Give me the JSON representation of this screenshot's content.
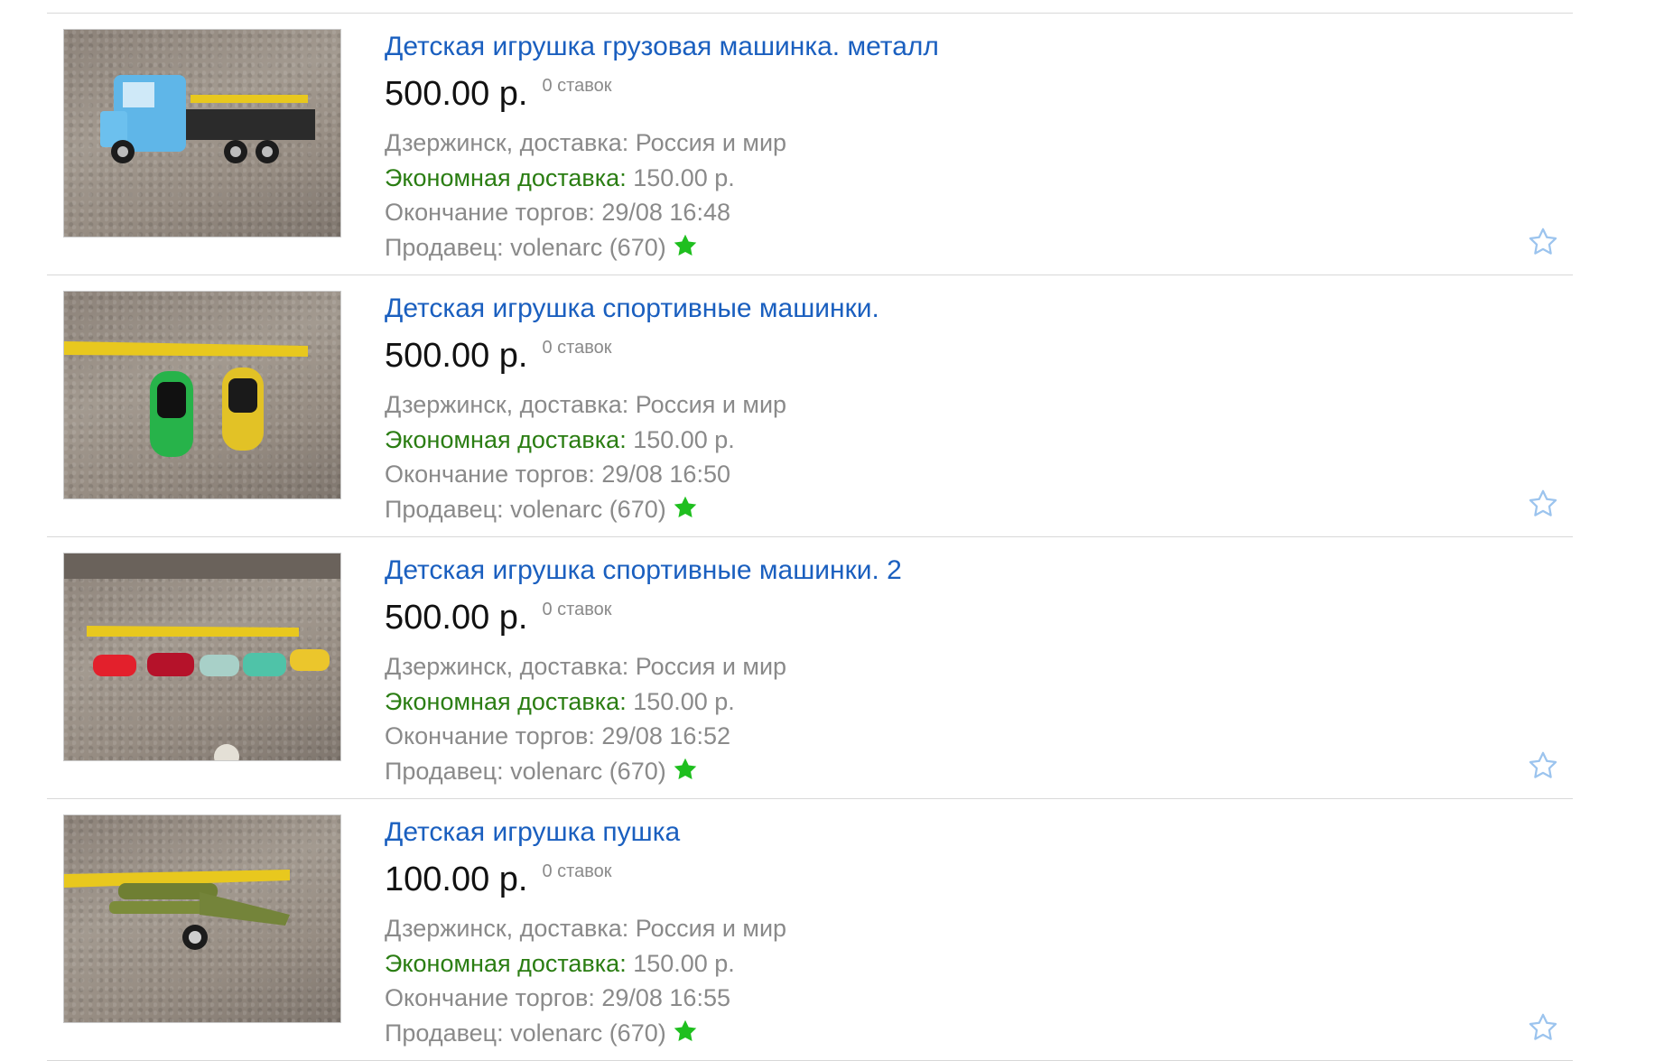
{
  "listings": [
    {
      "title": "Детская игрушка грузовая машинка. металл",
      "price": "500.00 р.",
      "bids": "0 ставок",
      "location": "Дзержинск, доставка: Россия и мир",
      "shipping_label": "Экономная доставка:",
      "shipping_price": " 150.00 р.",
      "end_time": "Окончание торгов: 29/08 16:48",
      "seller": "Продавец: volenarc (670)",
      "image": "blue toy truck with tape measure"
    },
    {
      "title": "Детская игрушка спортивные машинки.",
      "price": "500.00 р.",
      "bids": "0 ставок",
      "location": "Дзержинск, доставка: Россия и мир",
      "shipping_label": "Экономная доставка:",
      "shipping_price": " 150.00 р.",
      "end_time": "Окончание торгов: 29/08 16:50",
      "seller": "Продавец: volenarc (670)",
      "image": "green and yellow toy sports cars"
    },
    {
      "title": "Детская игрушка спортивные машинки. 2",
      "price": "500.00 р.",
      "bids": "0 ставок",
      "location": "Дзержинск, доставка: Россия и мир",
      "shipping_label": "Экономная доставка:",
      "shipping_price": " 150.00 р.",
      "end_time": "Окончание торгов: 29/08 16:52",
      "seller": "Продавец: volenarc (670)",
      "image": "row of small colorful toy cars"
    },
    {
      "title": "Детская игрушка пушка",
      "price": "100.00 р.",
      "bids": "0 ставок",
      "location": "Дзержинск, доставка: Россия и мир",
      "shipping_label": "Экономная доставка:",
      "shipping_price": " 150.00 р.",
      "end_time": "Окончание торгов: 29/08 16:55",
      "seller": "Продавец: volenarc (670)",
      "image": "green toy cannon"
    }
  ],
  "colors": {
    "title_link": "#1a5fbf",
    "shipping_label": "#2a7d12",
    "muted_text": "#8a8a8a",
    "seller_star": "#1fbf1f",
    "watch_star_outline": "#9cc4ee"
  },
  "icons": {
    "seller_rating": "green-star-icon",
    "watch": "star-outline-icon"
  }
}
